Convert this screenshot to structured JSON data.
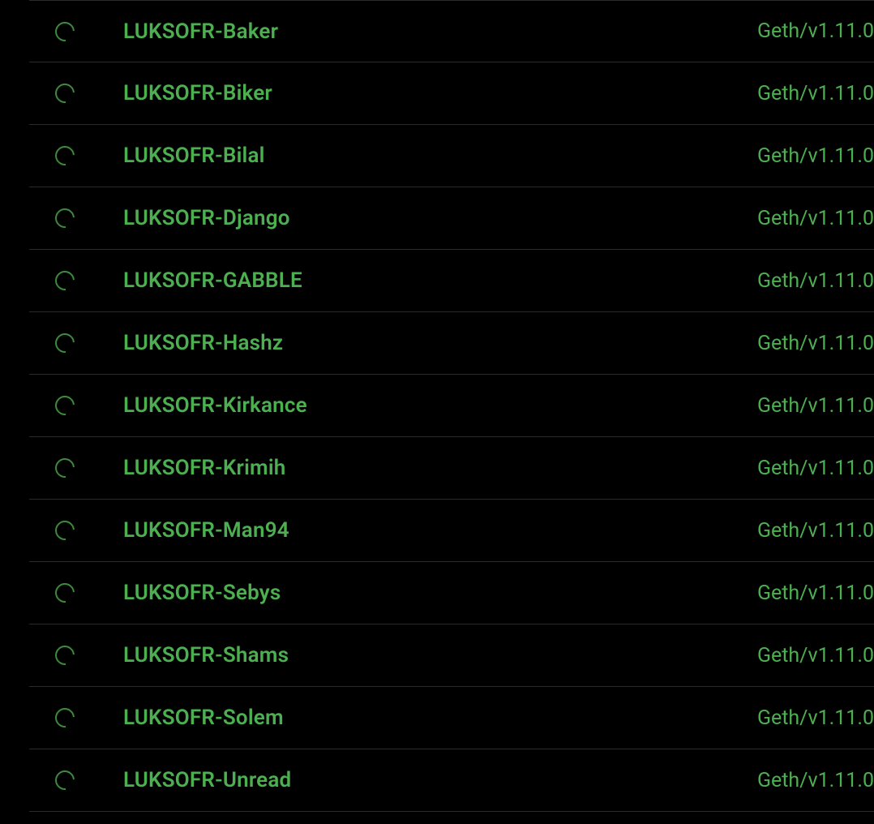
{
  "nodes": [
    {
      "name": "LUKSOFR-Baker",
      "version": "Geth/v1.11.0"
    },
    {
      "name": "LUKSOFR-Biker",
      "version": "Geth/v1.11.0"
    },
    {
      "name": "LUKSOFR-Bilal",
      "version": "Geth/v1.11.0"
    },
    {
      "name": "LUKSOFR-Django",
      "version": "Geth/v1.11.0"
    },
    {
      "name": "LUKSOFR-GABBLE",
      "version": "Geth/v1.11.0"
    },
    {
      "name": "LUKSOFR-Hashz",
      "version": "Geth/v1.11.0"
    },
    {
      "name": "LUKSOFR-Kirkance",
      "version": "Geth/v1.11.0"
    },
    {
      "name": "LUKSOFR-Krimih",
      "version": "Geth/v1.11.0"
    },
    {
      "name": "LUKSOFR-Man94",
      "version": "Geth/v1.11.0"
    },
    {
      "name": "LUKSOFR-Sebys",
      "version": "Geth/v1.11.0"
    },
    {
      "name": "LUKSOFR-Shams",
      "version": "Geth/v1.11.0"
    },
    {
      "name": "LUKSOFR-Solem",
      "version": "Geth/v1.11.0"
    },
    {
      "name": "LUKSOFR-Unread",
      "version": "Geth/v1.11.0"
    }
  ]
}
